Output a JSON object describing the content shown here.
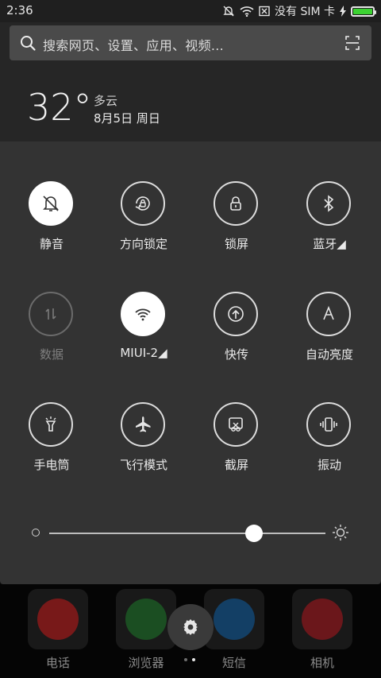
{
  "status_bar": {
    "time": "2:36",
    "sim_text": "没有 SIM 卡",
    "icons": [
      "muted-bell-icon",
      "wifi-icon",
      "no-sim-icon",
      "charging-icon",
      "battery-icon"
    ],
    "battery_level": 1.0,
    "battery_color": "#3cd232"
  },
  "search": {
    "placeholder": "搜索网页、设置、应用、视频...",
    "icons": [
      "search-icon",
      "scan-icon"
    ]
  },
  "weather": {
    "temperature": "32°",
    "condition": "多云",
    "date": "8月5日 周日"
  },
  "toggles": [
    {
      "label": "静音",
      "icon": "bell-off-icon",
      "state": "on"
    },
    {
      "label": "方向锁定",
      "icon": "rotation-lock-icon",
      "state": "normal"
    },
    {
      "label": "锁屏",
      "icon": "lock-icon",
      "state": "normal"
    },
    {
      "label": "蓝牙◢",
      "icon": "bluetooth-icon",
      "state": "normal"
    },
    {
      "label": "数据",
      "icon": "mobile-data-icon",
      "state": "disabled"
    },
    {
      "label": "MIUI-2◢",
      "icon": "wifi-icon",
      "state": "on"
    },
    {
      "label": "快传",
      "icon": "quick-transfer-icon",
      "state": "normal"
    },
    {
      "label": "自动亮度",
      "icon": "auto-brightness-icon",
      "state": "normal"
    },
    {
      "label": "手电筒",
      "icon": "flashlight-icon",
      "state": "normal"
    },
    {
      "label": "飞行模式",
      "icon": "airplane-icon",
      "state": "normal"
    },
    {
      "label": "截屏",
      "icon": "screenshot-icon",
      "state": "normal"
    },
    {
      "label": "振动",
      "icon": "vibrate-icon",
      "state": "normal"
    }
  ],
  "brightness": {
    "level": 0.74
  },
  "dock": {
    "apps": [
      {
        "label": "电话",
        "icon": "phone-app-icon",
        "color": "#d62b2b"
      },
      {
        "label": "浏览器",
        "icon": "browser-app-icon",
        "color": "#2e8b3a"
      },
      {
        "label": "短信",
        "icon": "messages-app-icon",
        "color": "#1f6fb5"
      },
      {
        "label": "相机",
        "icon": "camera-app-icon",
        "color": "#c0262d"
      }
    ],
    "page_indicator": {
      "pages": 2,
      "current": 2
    }
  }
}
